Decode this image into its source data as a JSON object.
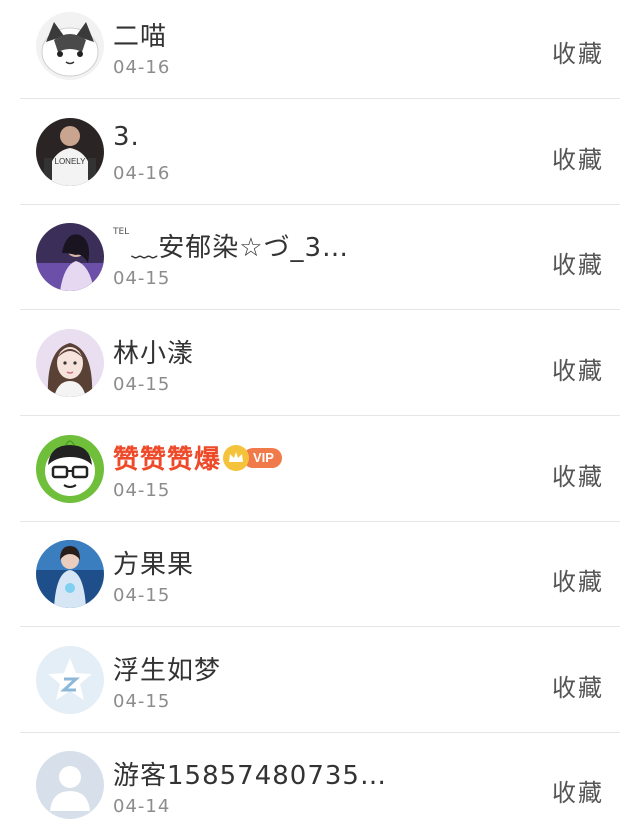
{
  "rows": [
    {
      "name": "二喵",
      "date": "04-16",
      "action": "收藏",
      "avatar": "cat-face"
    },
    {
      "name": "3.",
      "date": "04-16",
      "action": "收藏",
      "avatar": "person-white-shirt"
    },
    {
      "prefix": "TEL",
      "name": "﹏安郁染☆づ_3…",
      "date": "04-15",
      "action": "收藏",
      "avatar": "dark-photo"
    },
    {
      "name": "林小漾",
      "date": "04-15",
      "action": "收藏",
      "avatar": "girl-portrait"
    },
    {
      "name": "赞赞赞爆",
      "date": "04-15",
      "action": "收藏",
      "avatar": "cartoon-glasses",
      "badge": "VIP"
    },
    {
      "name": "方果果",
      "date": "04-15",
      "action": "收藏",
      "avatar": "blue-photo"
    },
    {
      "name": "浮生如梦",
      "date": "04-15",
      "action": "收藏",
      "avatar": "qq-star-default"
    },
    {
      "name": "游客15857480735…",
      "date": "04-14",
      "action": "收藏",
      "avatar": "default-person"
    }
  ],
  "colors": {
    "vip_name": "#ee4a2a",
    "vip_badge": "#f07a4a",
    "crown": "#f5c33b",
    "divider": "#e6e6e6"
  }
}
